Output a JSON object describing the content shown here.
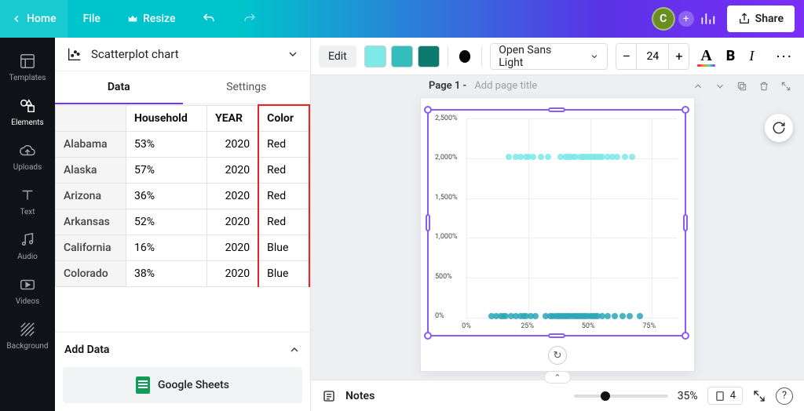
{
  "topbar": {
    "home": "Home",
    "file": "File",
    "resize": "Resize",
    "share": "Share",
    "avatar_initial": "C"
  },
  "rail": {
    "templates": "Templates",
    "elements": "Elements",
    "uploads": "Uploads",
    "text": "Text",
    "audio": "Audio",
    "videos": "Videos",
    "background": "Background"
  },
  "panel": {
    "chart_type": "Scatterplot chart",
    "tab_data": "Data",
    "tab_settings": "Settings",
    "columns": {
      "c1": "Household",
      "c2": "YEAR",
      "c3": "Color"
    },
    "rows": [
      {
        "state": "Alabama",
        "household": "53%",
        "year": "2020",
        "color": "Red"
      },
      {
        "state": "Alaska",
        "household": "57%",
        "year": "2020",
        "color": "Red"
      },
      {
        "state": "Arizona",
        "household": "36%",
        "year": "2020",
        "color": "Red"
      },
      {
        "state": "Arkansas",
        "household": "52%",
        "year": "2020",
        "color": "Red"
      },
      {
        "state": "California",
        "household": "16%",
        "year": "2020",
        "color": "Blue"
      },
      {
        "state": "Colorado",
        "household": "38%",
        "year": "2020",
        "color": "Blue"
      }
    ],
    "add_data": "Add Data",
    "google_sheets": "Google Sheets"
  },
  "ctoolbar": {
    "edit": "Edit",
    "swatches": [
      "#7fe8e8",
      "#33bdbd",
      "#0d7a6f"
    ],
    "dot": "#000000",
    "font": "Open Sans Light",
    "font_size": "24"
  },
  "page": {
    "label": "Page 1 - ",
    "placeholder": "Add page title"
  },
  "bottom": {
    "notes": "Notes",
    "zoom": "35%",
    "page_count": "4"
  },
  "chart_data": {
    "type": "scatter",
    "title": "",
    "xlabel": "",
    "ylabel": "",
    "xlim": [
      0,
      85
    ],
    "ylim": [
      0,
      2500
    ],
    "x_ticks": [
      "0%",
      "25%",
      "50%",
      "75%"
    ],
    "y_ticks": [
      "0%",
      "500%",
      "1,000%",
      "1,500%",
      "2,000%",
      "2,500%"
    ],
    "series": [
      {
        "name": "teal-light",
        "color": "#7fe8e8",
        "points": [
          [
            17,
            2020
          ],
          [
            20,
            2020
          ],
          [
            22,
            2020
          ],
          [
            24,
            2020
          ],
          [
            25,
            2020
          ],
          [
            27,
            2020
          ],
          [
            30,
            2020
          ],
          [
            33,
            2020
          ],
          [
            38,
            2020
          ],
          [
            40,
            2020
          ],
          [
            41,
            2020
          ],
          [
            42,
            2020
          ],
          [
            43,
            2020
          ],
          [
            44,
            2020
          ],
          [
            46,
            2020
          ],
          [
            47,
            2020
          ],
          [
            48,
            2020
          ],
          [
            49,
            2020
          ],
          [
            50,
            2020
          ],
          [
            51,
            2020
          ],
          [
            52,
            2020
          ],
          [
            53,
            2020
          ],
          [
            54,
            2020
          ],
          [
            55,
            2020
          ],
          [
            57,
            2020
          ],
          [
            59,
            2020
          ],
          [
            61,
            2020
          ],
          [
            64,
            2020
          ],
          [
            67,
            2020
          ]
        ]
      },
      {
        "name": "teal-dark",
        "color": "#2aa6b9",
        "points": [
          [
            10,
            20
          ],
          [
            12,
            20
          ],
          [
            14,
            20
          ],
          [
            15,
            20
          ],
          [
            16,
            20
          ],
          [
            18,
            20
          ],
          [
            20,
            20
          ],
          [
            22,
            20
          ],
          [
            23,
            20
          ],
          [
            24,
            20
          ],
          [
            26,
            20
          ],
          [
            28,
            20
          ],
          [
            32,
            20
          ],
          [
            34,
            20
          ],
          [
            35,
            20
          ],
          [
            36,
            20
          ],
          [
            37,
            20
          ],
          [
            38,
            20
          ],
          [
            39,
            20
          ],
          [
            40,
            20
          ],
          [
            41,
            20
          ],
          [
            42,
            20
          ],
          [
            43,
            20
          ],
          [
            44,
            20
          ],
          [
            45,
            20
          ],
          [
            46,
            20
          ],
          [
            47,
            20
          ],
          [
            48,
            20
          ],
          [
            49,
            20
          ],
          [
            50,
            20
          ],
          [
            51,
            20
          ],
          [
            52,
            20
          ],
          [
            53,
            20
          ],
          [
            55,
            20
          ],
          [
            57,
            20
          ],
          [
            60,
            20
          ],
          [
            63,
            20
          ],
          [
            66,
            20
          ],
          [
            70,
            20
          ]
        ]
      }
    ]
  }
}
